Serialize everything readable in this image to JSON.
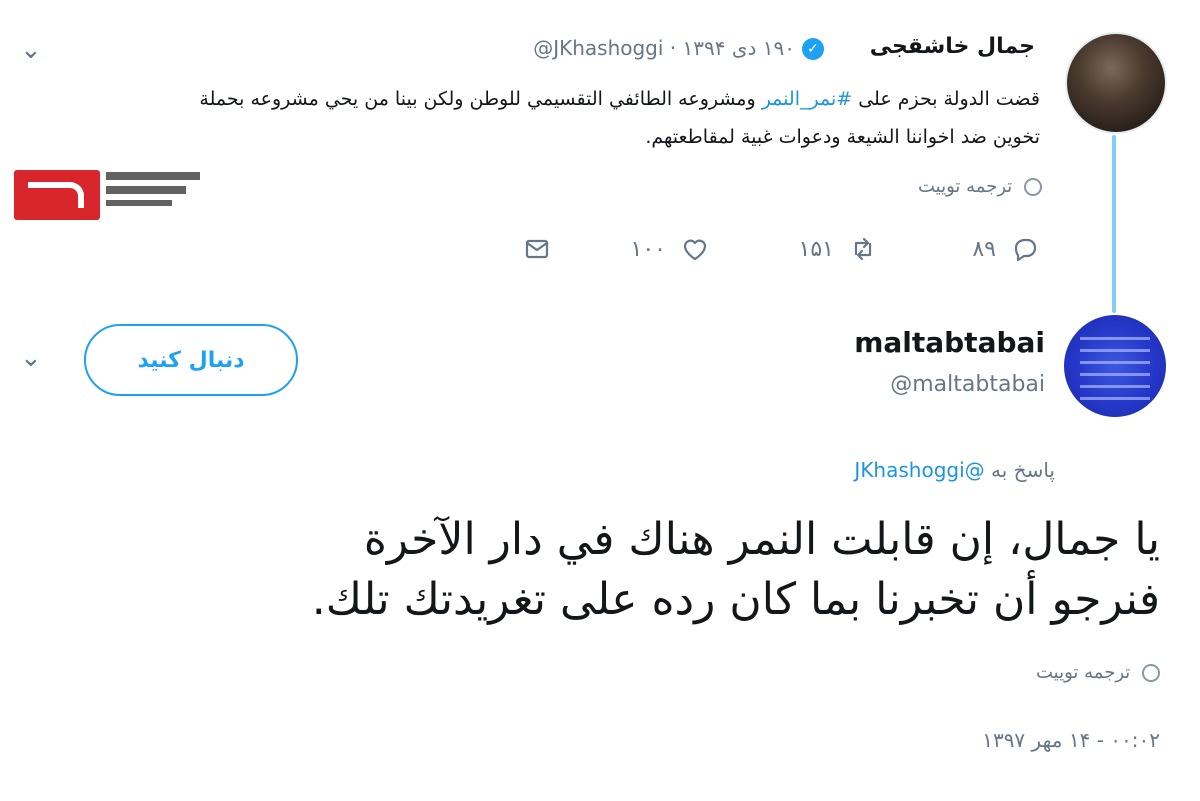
{
  "parent": {
    "author_name": "جمال خاشقجی",
    "handle": "@JKhashoggi",
    "date": "۱۹۰ دی ۱۳۹۴",
    "separator": "·",
    "text_before": "قضت الدولة بحزم على",
    "hashtag": "#نمر_النمر",
    "text_after": "ومشروعه الطائفي التقسيمي للوطن ولكن بينا من يحي مشروعه بحملة تخوين ضد اخواننا الشيعة ودعوات غبية لمقاطعتهم.",
    "translate_label": "ترجمه توییت",
    "actions": {
      "reply_count": "۸۹",
      "retweet_count": "۱۵۱",
      "like_count": "۱۰۰"
    },
    "icons": [
      "chevron-down-icon",
      "verified-icon",
      "globe-icon",
      "reply-icon",
      "retweet-icon",
      "like-icon",
      "message-icon"
    ]
  },
  "reply": {
    "author_name": "maltabtabai",
    "handle": "@maltabtabai",
    "follow_label": "دنبال کنید",
    "reply_to_prefix": "پاسخ به",
    "reply_to_handle": "@JKhashoggi",
    "line1": "يا جمال، إن قابلت النمر هناك في دار الآخرة",
    "line2": "فنرجو أن تخبرنا بما كان رده على تغريدتك تلك.",
    "translate_label": "ترجمه توییت",
    "timestamp": "۰۰:۰۲ - ۱۴ مهر ۱۳۹۷"
  },
  "colors": {
    "accent": "#1da1f2",
    "link": "#1b95e0",
    "muted": "#657786",
    "logo_red": "#d8262c"
  }
}
